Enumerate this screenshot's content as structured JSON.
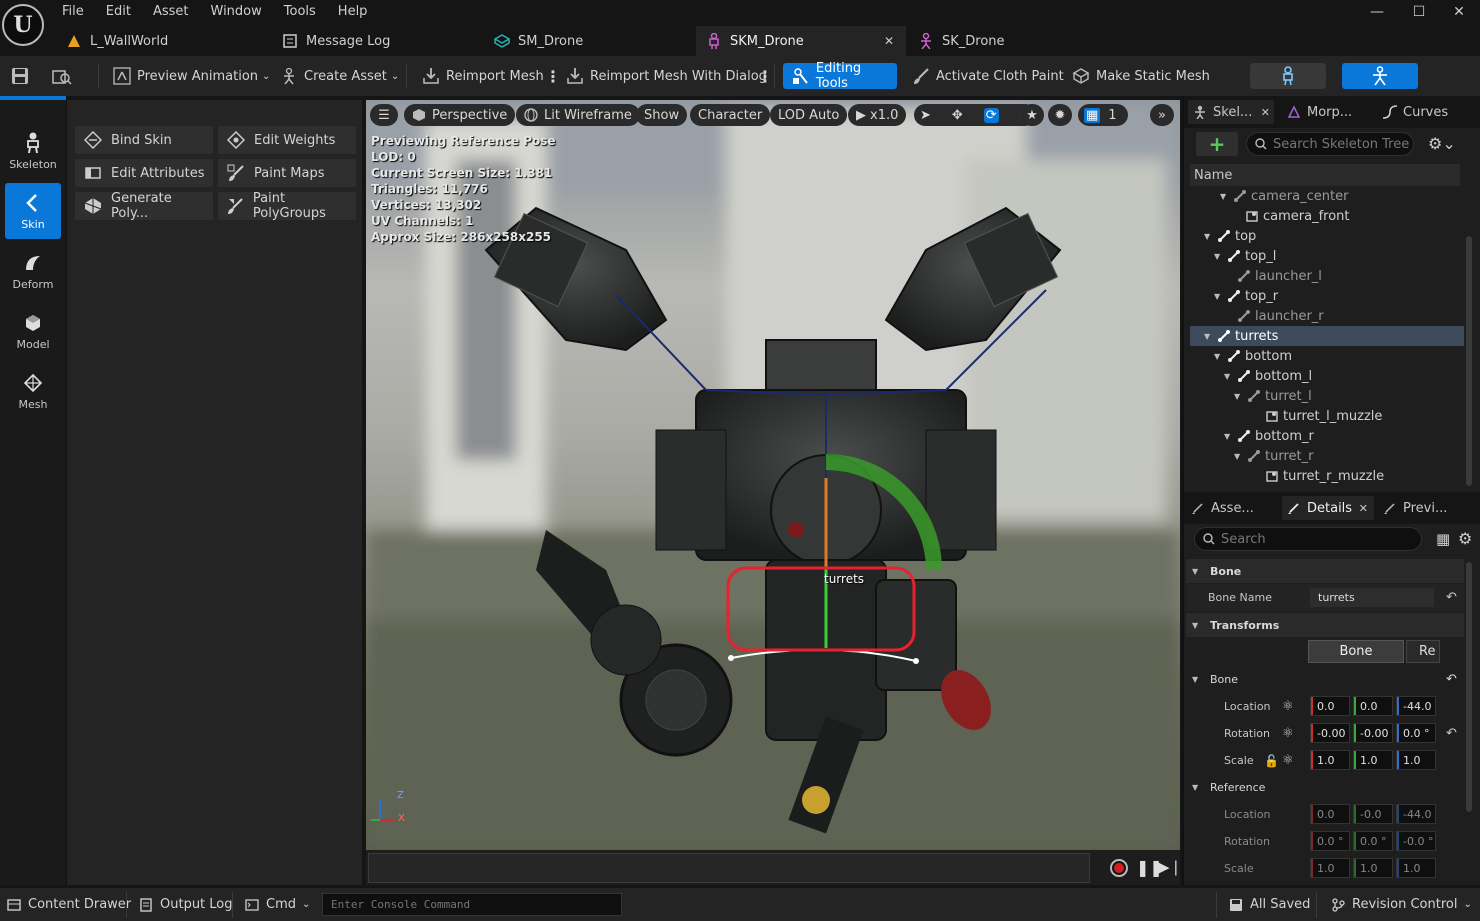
{
  "menu": [
    "File",
    "Edit",
    "Asset",
    "Window",
    "Tools",
    "Help"
  ],
  "doc_tabs": [
    {
      "label": "L_WallWorld",
      "icon": "level-icon"
    },
    {
      "label": "Message Log",
      "icon": "log-icon"
    },
    {
      "label": "SM_Drone",
      "icon": "static-mesh-icon"
    },
    {
      "label": "SKM_Drone",
      "icon": "skeletal-mesh-icon",
      "active": true
    },
    {
      "label": "SK_Drone",
      "icon": "skeleton-icon"
    }
  ],
  "toolbar": {
    "preview_animation": "Preview Animation",
    "create_asset": "Create Asset",
    "reimport_mesh": "Reimport Mesh",
    "reimport_mesh_dialog": "Reimport Mesh With Dialog",
    "editing_tools": "Editing Tools",
    "activate_cloth_paint": "Activate Cloth Paint",
    "make_static_mesh": "Make Static Mesh"
  },
  "modes": [
    {
      "label": "Skeleton",
      "icon": "skeleton-icon"
    },
    {
      "label": "Skin",
      "icon": "skin-icon",
      "active": true
    },
    {
      "label": "Deform",
      "icon": "deform-icon"
    },
    {
      "label": "Model",
      "icon": "model-icon"
    },
    {
      "label": "Mesh",
      "icon": "mesh-icon"
    }
  ],
  "tools": [
    {
      "label": "Bind Skin",
      "icon": "bind-skin-icon"
    },
    {
      "label": "Edit Weights",
      "icon": "edit-weights-icon"
    },
    {
      "label": "Edit Attributes",
      "icon": "edit-attributes-icon"
    },
    {
      "label": "Paint Maps",
      "icon": "paint-maps-icon"
    },
    {
      "label": "Generate Poly...",
      "icon": "generate-poly-icon"
    },
    {
      "label": "Paint PolyGroups",
      "icon": "paint-polygroups-icon"
    }
  ],
  "viewport": {
    "perspective": "Perspective",
    "view_mode": "Lit Wireframe",
    "show": "Show",
    "character": "Character",
    "lod": "LOD Auto",
    "speed": "x1.0",
    "grid_count": "1",
    "stats": [
      "Previewing Reference Pose",
      "LOD: 0",
      "Current Screen Size: 1.381",
      "Triangles: 11,776",
      "Vertices: 13,302",
      "UV Channels: 1",
      "Approx Size: 286x258x255"
    ],
    "selected_bone_label": "turrets",
    "axis_z": "Z",
    "axis_x": "X",
    "highlight_color": "#e8212e"
  },
  "skeleton_panel": {
    "tabs": [
      "Skel...",
      "Morp...",
      "Curves"
    ],
    "search_placeholder": "Search Skeleton Tree",
    "column": "Name",
    "bones": [
      {
        "name": "camera_center",
        "type": "bone-dim"
      },
      {
        "name": "camera_front",
        "type": "socket"
      },
      {
        "name": "top",
        "type": "bone"
      },
      {
        "name": "top_l",
        "type": "bone"
      },
      {
        "name": "launcher_l",
        "type": "bone-dim"
      },
      {
        "name": "top_r",
        "type": "bone"
      },
      {
        "name": "launcher_r",
        "type": "bone-dim"
      },
      {
        "name": "turrets",
        "type": "bone",
        "selected": true
      },
      {
        "name": "bottom",
        "type": "bone"
      },
      {
        "name": "bottom_l",
        "type": "bone"
      },
      {
        "name": "turret_l",
        "type": "bone-dim"
      },
      {
        "name": "turret_l_muzzle",
        "type": "socket"
      },
      {
        "name": "bottom_r",
        "type": "bone"
      },
      {
        "name": "turret_r",
        "type": "bone-dim"
      },
      {
        "name": "turret_r_muzzle",
        "type": "socket"
      }
    ]
  },
  "details_panel": {
    "tabs": [
      "Asse...",
      "Details",
      "Previ..."
    ],
    "search_placeholder": "Search",
    "bone_section": "Bone",
    "bone_name_label": "Bone Name",
    "bone_name_value": "turrets",
    "transforms_section": "Transforms",
    "transform_toggle": [
      "Bone",
      "Re"
    ],
    "bone_group": "Bone",
    "location_label": "Location",
    "rotation_label": "Rotation",
    "scale_label": "Scale",
    "bone_location": [
      "0.0",
      "0.0",
      "-44.0"
    ],
    "bone_rotation": [
      "-0.00",
      "-0.00",
      "0.0 °"
    ],
    "bone_scale": [
      "1.0",
      "1.0",
      "1.0"
    ],
    "reference_group": "Reference",
    "ref_location": [
      "0.0",
      "-0.0",
      "-44.0"
    ],
    "ref_rotation": [
      "0.0 °",
      "0.0 °",
      "-0.0 °"
    ],
    "ref_scale": [
      "1.0",
      "1.0",
      "1.0"
    ]
  },
  "statusbar": {
    "content_drawer": "Content Drawer",
    "output_log": "Output Log",
    "cmd": "Cmd",
    "console_placeholder": "Enter Console Command",
    "all_saved": "All Saved",
    "revision_control": "Revision Control"
  },
  "colors": {
    "accent": "#0a78d8",
    "x_axis": "#c83030",
    "y_axis": "#3aa83a",
    "z_axis": "#2c6fd0"
  }
}
